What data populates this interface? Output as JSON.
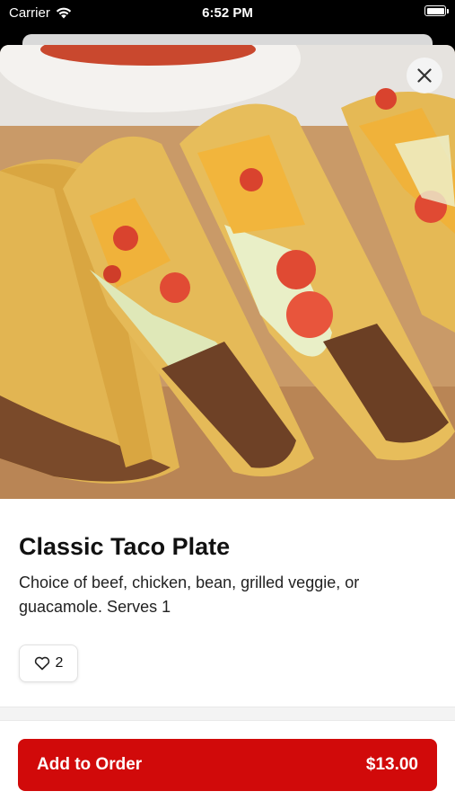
{
  "status_bar": {
    "carrier": "Carrier",
    "time": "6:52 PM",
    "icons": [
      "wifi-icon",
      "battery-icon"
    ]
  },
  "item": {
    "image": "taco-plate-photo",
    "title": "Classic Taco Plate",
    "description": "Choice of beef, chicken, bean, grilled veggie, or guacamole. Serves 1",
    "likes": "2"
  },
  "actions": {
    "close_icon": "close-icon",
    "like_icon": "heart-icon",
    "add_label": "Add to Order",
    "price": "$13.00"
  },
  "colors": {
    "accent": "#d10a0a",
    "background": "#ffffff",
    "status_bar": "#000000"
  }
}
